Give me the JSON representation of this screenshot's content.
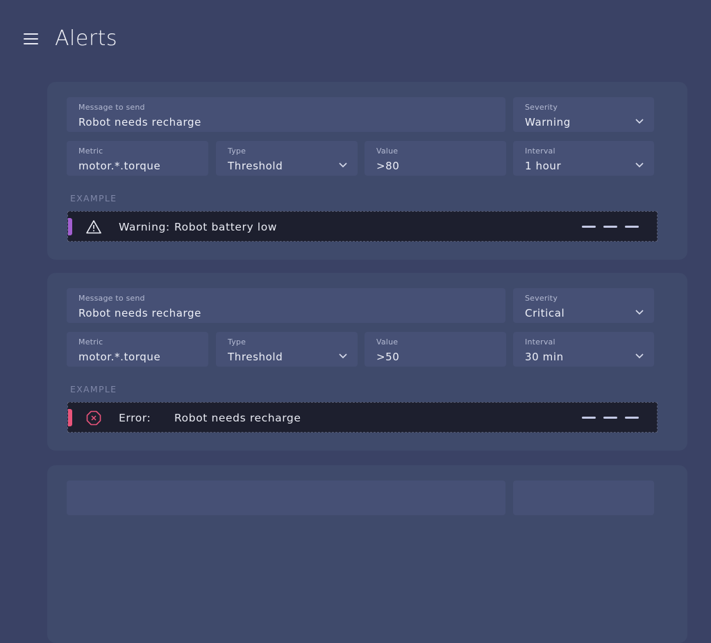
{
  "header": {
    "title": "Alerts",
    "menu_icon": "hamburger-menu-icon"
  },
  "alerts": [
    {
      "message": {
        "label": "Message to send",
        "value": "Robot needs recharge"
      },
      "severity": {
        "label": "Severity",
        "value": "Warning"
      },
      "metric": {
        "label": "Metric",
        "value": "motor.*.torque"
      },
      "type": {
        "label": "Type",
        "value": "Threshold"
      },
      "value": {
        "label": "Value",
        "value": ">80"
      },
      "interval": {
        "label": "Interval",
        "value": "1 hour"
      },
      "example": {
        "label": "EXAMPLE",
        "kind": "Warning:",
        "message": "Robot battery low",
        "icon": "warning-triangle-icon",
        "accent": "#a25fd0"
      }
    },
    {
      "message": {
        "label": "Message to send",
        "value": "Robot needs recharge"
      },
      "severity": {
        "label": "Severity",
        "value": "Critical"
      },
      "metric": {
        "label": "Metric",
        "value": "motor.*.torque"
      },
      "type": {
        "label": "Type",
        "value": "Threshold"
      },
      "value": {
        "label": "Value",
        "value": ">50"
      },
      "interval": {
        "label": "Interval",
        "value": "30 min"
      },
      "example": {
        "label": "EXAMPLE",
        "kind": "Error:",
        "message": "Robot needs recharge",
        "icon": "error-octagon-icon",
        "accent": "#e9547a"
      }
    }
  ]
}
